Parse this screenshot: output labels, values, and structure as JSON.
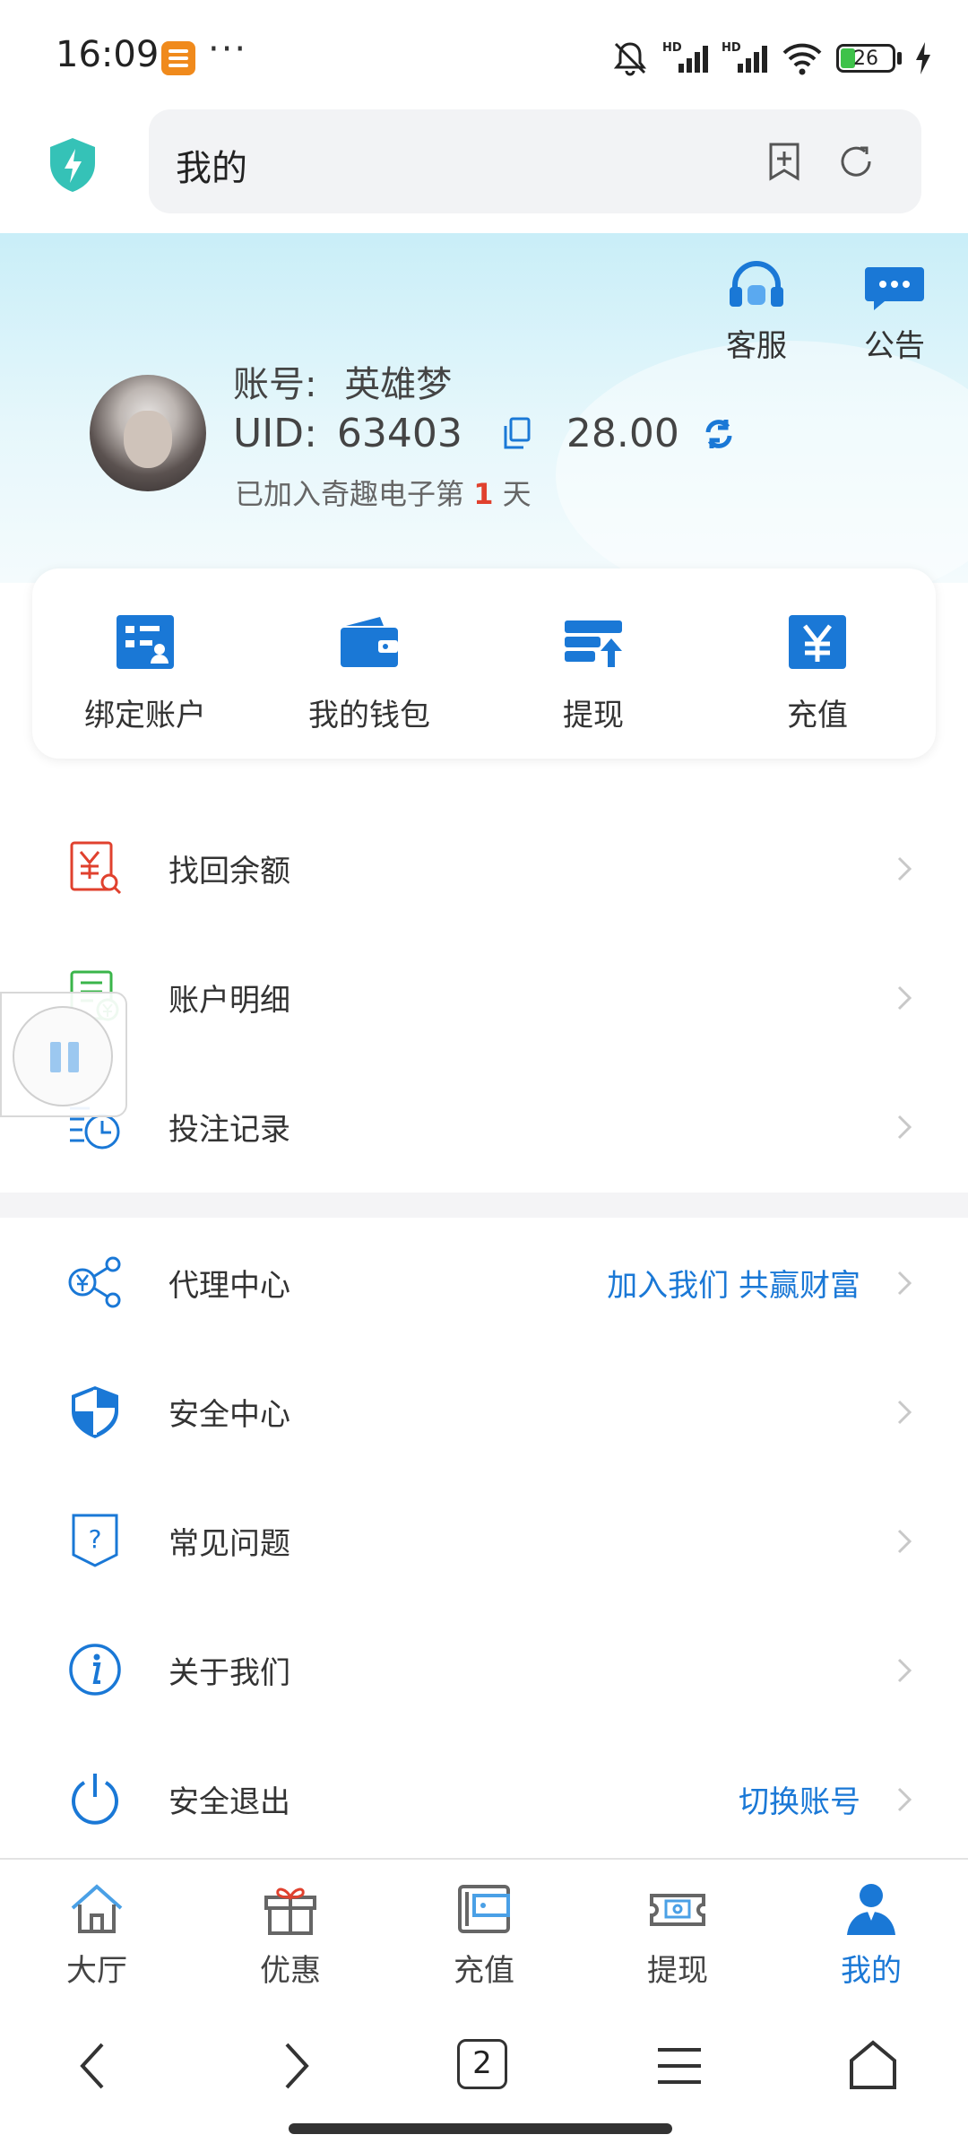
{
  "status_bar": {
    "time": "16:09",
    "dots": "···",
    "battery": "26",
    "icons": [
      "notifications-muted-icon",
      "signal-hd-icon",
      "signal-hd-icon",
      "wifi-icon",
      "battery-icon",
      "charging-icon"
    ]
  },
  "browser": {
    "title": "我的",
    "icons": [
      "shield-logo-icon",
      "add-bookmark-icon",
      "refresh-icon"
    ]
  },
  "top_actions": [
    {
      "label": "客服",
      "icon": "headset-icon"
    },
    {
      "label": "公告",
      "icon": "chat-bubble-icon"
    }
  ],
  "profile": {
    "account_label": "账号:",
    "account_name": "英雄梦",
    "uid_label": "UID:",
    "uid": "63403",
    "balance": "28.00",
    "days_prefix": "已加入奇趣电子第",
    "days": "1",
    "days_suffix": "天"
  },
  "quick_actions": [
    {
      "label": "绑定账户",
      "icon": "bind-account-icon"
    },
    {
      "label": "我的钱包",
      "icon": "wallet-icon"
    },
    {
      "label": "提现",
      "icon": "withdraw-icon"
    },
    {
      "label": "充值",
      "icon": "yuan-icon"
    }
  ],
  "menu_group1": [
    {
      "label": "找回余额",
      "icon": "recover-balance-icon"
    },
    {
      "label": "账户明细",
      "icon": "account-detail-icon"
    },
    {
      "label": "投注记录",
      "icon": "bet-record-icon"
    }
  ],
  "menu_group2": [
    {
      "label": "代理中心",
      "extra": "加入我们 共赢财富",
      "icon": "share-yuan-icon"
    },
    {
      "label": "安全中心",
      "extra": "",
      "icon": "shield-icon"
    },
    {
      "label": "常见问题",
      "extra": "",
      "icon": "question-icon"
    },
    {
      "label": "关于我们",
      "extra": "",
      "icon": "info-icon"
    },
    {
      "label": "安全退出",
      "extra": "切换账号",
      "icon": "power-icon"
    }
  ],
  "tabs": [
    {
      "label": "大厅",
      "icon": "home-icon",
      "active": false
    },
    {
      "label": "优惠",
      "icon": "gift-icon",
      "active": false
    },
    {
      "label": "充值",
      "icon": "wallet-card-icon",
      "active": false
    },
    {
      "label": "提现",
      "icon": "cash-ticket-icon",
      "active": false
    },
    {
      "label": "我的",
      "icon": "user-icon",
      "active": true
    }
  ],
  "nav": {
    "tab_count": "2",
    "icons": [
      "back-icon",
      "forward-icon",
      "tabs-icon",
      "menu-icon",
      "home-outline-icon"
    ]
  },
  "colors": {
    "accent": "#1a78d6",
    "highlight": "#e0412e",
    "hero": "#c9eef8"
  }
}
